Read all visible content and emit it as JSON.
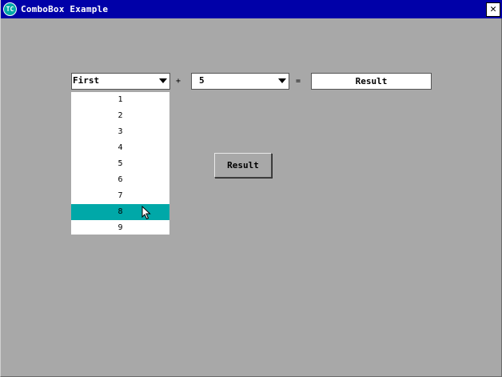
{
  "window": {
    "title": "ComboBox Example",
    "icon_text": "TC",
    "close_label": "✕"
  },
  "form": {
    "first_combo_value": "First",
    "plus_label": "+",
    "second_combo_value": "5",
    "equals_label": "=",
    "result_field_value": "Result",
    "result_button_label": "Result"
  },
  "dropdown": {
    "items": [
      "1",
      "2",
      "3",
      "4",
      "5",
      "6",
      "7",
      "8",
      "9"
    ],
    "selected_index": 7
  },
  "colors": {
    "titlebar": "#0000a8",
    "background": "#a8a8a8",
    "selection": "#00a8a8"
  }
}
